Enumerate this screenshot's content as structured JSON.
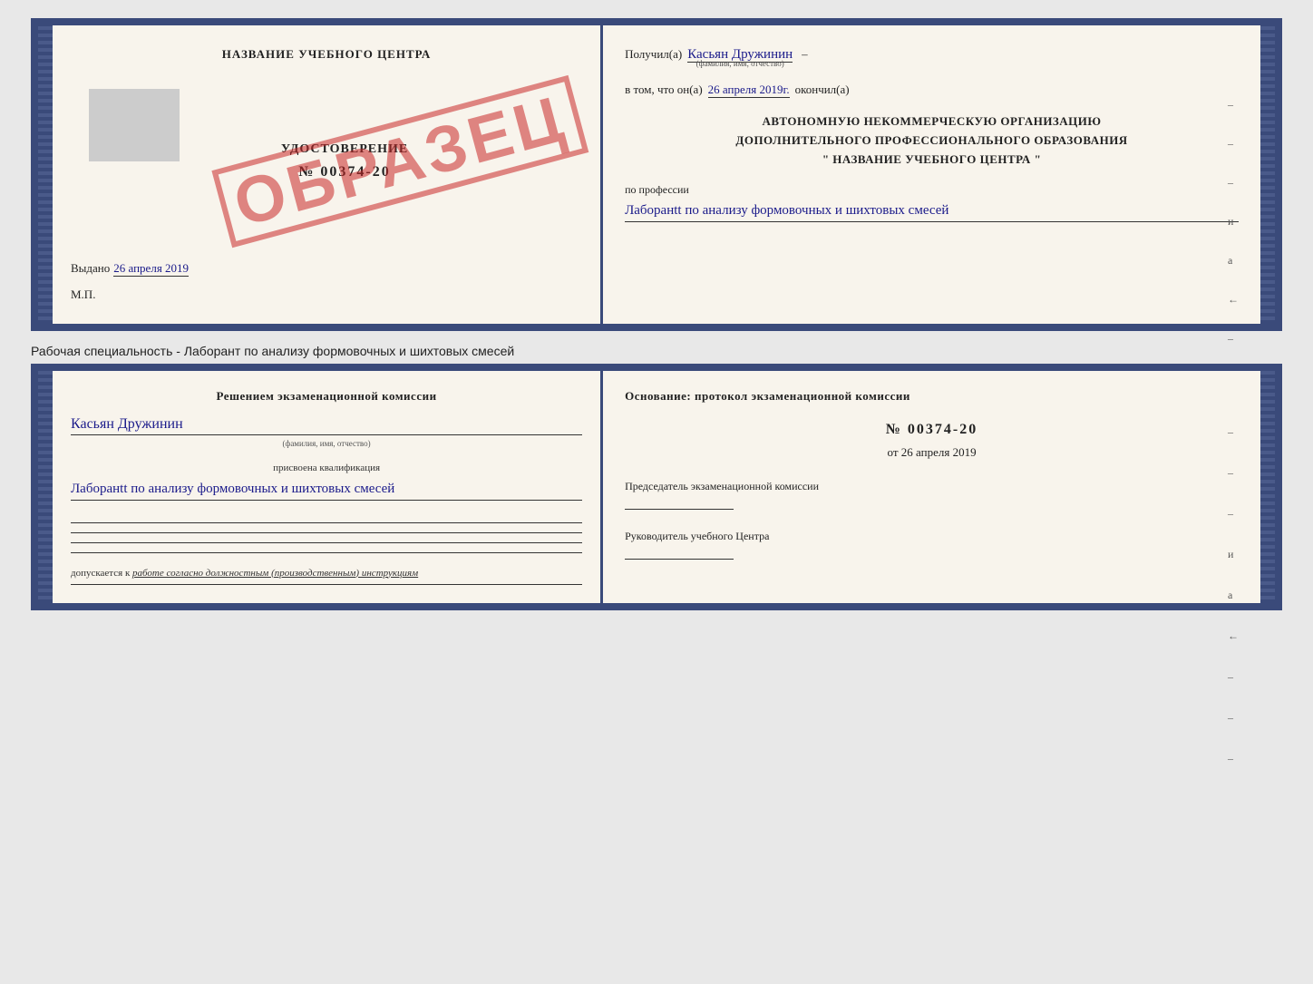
{
  "top_cert": {
    "left": {
      "title": "НАЗВАНИЕ УЧЕБНОГО ЦЕНТРА",
      "doc_title": "УДОСТОВЕРЕНИЕ",
      "doc_number": "№ 00374-20",
      "stamp_text": "ОБРАЗЕЦ",
      "issued_label": "Выдано",
      "issued_date": "26 апреля 2019",
      "mp_label": "М.П."
    },
    "right": {
      "received_label": "Получил(а)",
      "received_name": "Касьян Дружинин",
      "received_sub": "(фамилия, имя, отчество)",
      "completed_label": "в том, что он(а)",
      "completed_date": "26 апреля 2019г.",
      "completed_suffix": "окончил(а)",
      "org_line1": "АВТОНОМНУЮ НЕКОММЕРЧЕСКУЮ ОРГАНИЗАЦИЮ",
      "org_line2": "ДОПОЛНИТЕЛЬНОГО ПРОФЕССИОНАЛЬНОГО ОБРАЗОВАНИЯ",
      "org_line3": "\"  НАЗВАНИЕ УЧЕБНОГО ЦЕНТРА  \"",
      "profession_label": "по профессии",
      "profession_value": "Лаборанtt по анализу формовочных и шихтовых смесей",
      "side_dashes": [
        "-",
        "-",
        "-",
        "и",
        "а",
        "←",
        "-",
        "-",
        "-"
      ]
    }
  },
  "specialty_line": "Рабочая специальность - Лаборант по анализу формовочных и шихтовых смесей",
  "bottom_cert": {
    "left": {
      "decision_label": "Решением экзаменационной комиссии",
      "name": "Касьян Дружинин",
      "name_sub": "(фамилия, имя, отчество)",
      "qual_label": "присвоена квалификация",
      "qual_value": "Лаборанtt по анализу формовочных и шихтовых смесей",
      "permission_prefix": "допускается к",
      "permission_text": "работе согласно должностным (производственным) инструкциям"
    },
    "right": {
      "basis_label": "Основание: протокол экзаменационной комиссии",
      "protocol_number": "№ 00374-20",
      "date_prefix": "от",
      "date_value": "26 апреля 2019",
      "chair_label": "Председатель экзаменационной комиссии",
      "director_label": "Руководитель учебного Центра",
      "side_dashes": [
        "-",
        "-",
        "-",
        "и",
        "а",
        "←",
        "-",
        "-",
        "-"
      ]
    }
  }
}
